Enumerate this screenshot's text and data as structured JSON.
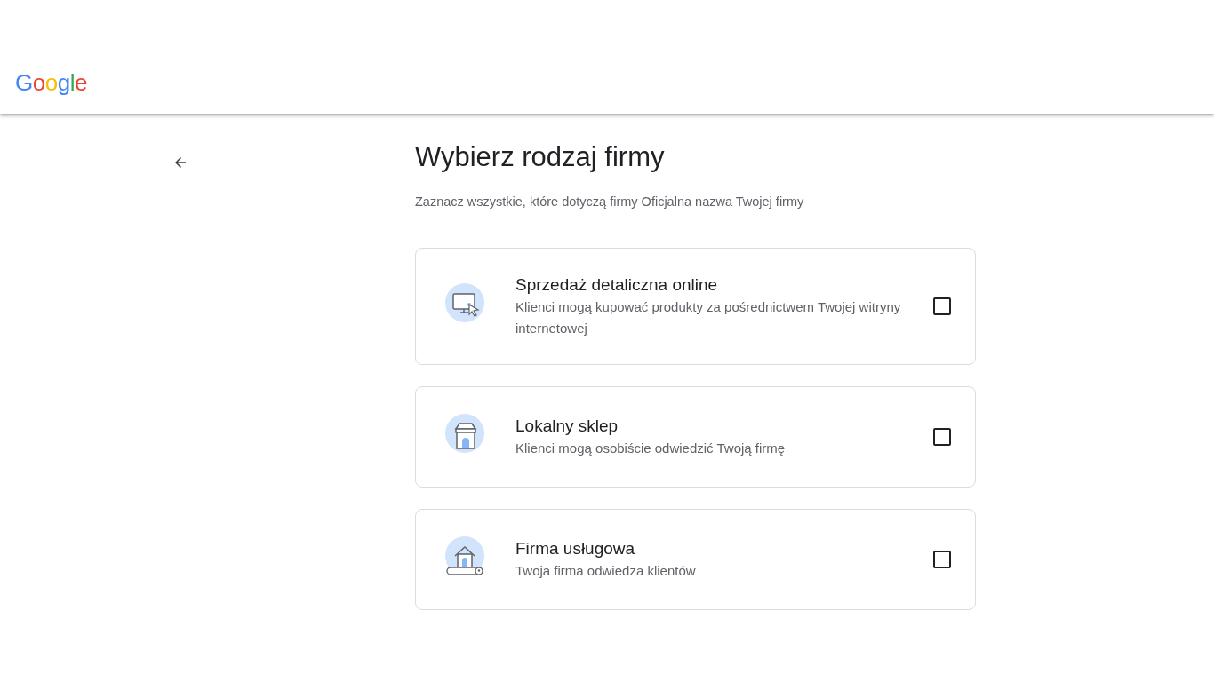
{
  "header": {
    "logo": "Google"
  },
  "title": "Wybierz rodzaj firmy",
  "subtitle": "Zaznacz wszystkie, które dotyczą firmy Oficjalna nazwa Twojej firmy",
  "options": [
    {
      "kind": "online",
      "title": "Sprzedaż detaliczna online",
      "description": "Klienci mogą kupować produkty za pośrednictwem Twojej witryny internetowej",
      "checked": false
    },
    {
      "kind": "store",
      "title": "Lokalny sklep",
      "description": "Klienci mogą osobiście odwiedzić Twoją firmę",
      "checked": false
    },
    {
      "kind": "service",
      "title": "Firma usługowa",
      "description": "Twoja firma odwiedza klientów",
      "checked": false
    }
  ]
}
